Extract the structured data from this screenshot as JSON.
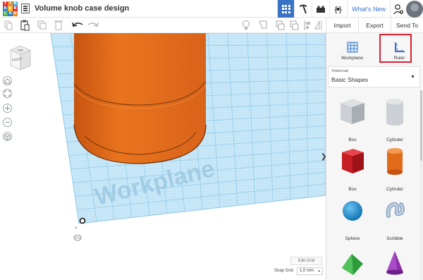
{
  "header": {
    "logo_letters": [
      "T",
      "I",
      "N",
      "K",
      "E",
      "R",
      "C",
      "A",
      "D"
    ],
    "doc_title": "Volume knob case design",
    "whats_new": "What's New",
    "icons": [
      "menu-icon",
      "grid-view-icon",
      "pickaxe-icon",
      "brick-icon",
      "codeblocks-icon",
      "add-user-icon",
      "avatar"
    ]
  },
  "toolbar": {
    "icons": [
      "copy-icon",
      "paste-icon",
      "duplicate-icon",
      "delete-icon",
      "undo-icon",
      "redo-icon",
      "note-icon",
      "show-hidden-icon",
      "lock-icon",
      "hide-icon",
      "align-icon",
      "mirror-icon",
      "group-icon",
      "ungroup-icon"
    ]
  },
  "actions": {
    "import": "Import",
    "export": "Export",
    "send_to": "Send To"
  },
  "viewcube": {
    "top": "TOP",
    "front": "FRONT"
  },
  "viewport": {
    "workplane_text": "Workplane",
    "edit_grid": "Edit Grid",
    "snap_grid_label": "Snap Grid",
    "snap_grid_value": "1.0 mm",
    "collapse_glyph": "❯"
  },
  "panel": {
    "workplane_label": "Workplane",
    "ruler_label": "Ruler",
    "library_small": "Tinkercad",
    "library_big": "Basic Shapes",
    "shapes": [
      {
        "label": "Box",
        "kind": "box-hole"
      },
      {
        "label": "Cylinder",
        "kind": "cylinder-hole"
      },
      {
        "label": "Box",
        "kind": "box"
      },
      {
        "label": "Cylinder",
        "kind": "cylinder"
      },
      {
        "label": "Sphere",
        "kind": "sphere"
      },
      {
        "label": "Scribble",
        "kind": "scribble"
      },
      {
        "label": "",
        "kind": "roof"
      },
      {
        "label": "",
        "kind": "cone"
      }
    ]
  },
  "colors": {
    "accent": "#3b73c4",
    "workplane": "#bfe2f5",
    "grid_line": "#9fd0ea",
    "cylinder": "#e06c1a",
    "highlight": "#d92231"
  }
}
